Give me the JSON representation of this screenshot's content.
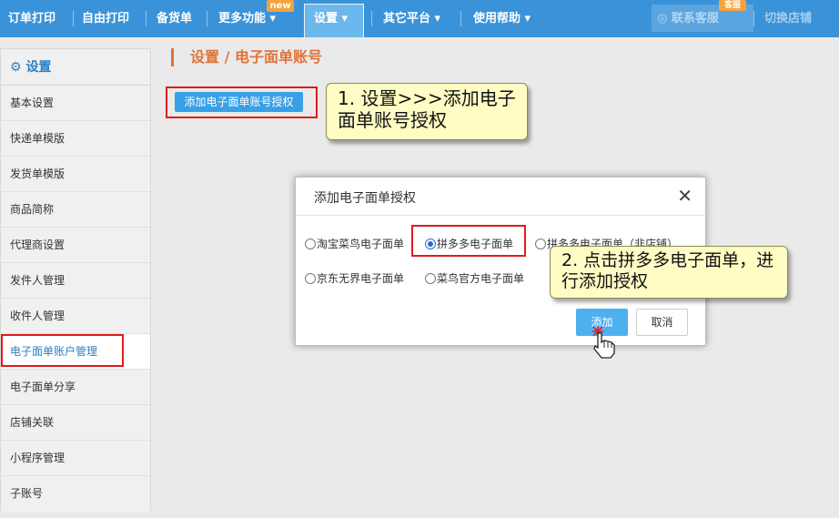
{
  "nav": {
    "items": [
      "订单打印",
      "自由打印",
      "备货单",
      "更多功能 ▾",
      "设置 ▾",
      "其它平台 ▾",
      "使用帮助 ▾"
    ],
    "new_badge": "new",
    "kefu_badge": "客服",
    "contact": "联系客服",
    "switch_store": "切换店铺"
  },
  "sidebar": {
    "header": "设置",
    "items": [
      "基本设置",
      "快递单模版",
      "发货单模版",
      "商品简称",
      "代理商设置",
      "发件人管理",
      "收件人管理",
      "电子面单账户管理",
      "电子面单分享",
      "店铺关联",
      "小程序管理",
      "子账号"
    ]
  },
  "page": {
    "title": "设置 / 电子面单账号",
    "auth_button": "添加电子面单账号授权"
  },
  "callouts": {
    "step1": "1. 设置>>>添加电子面单账号授权",
    "step2": "2. 点击拼多多电子面单，进行添加授权"
  },
  "dialog": {
    "title": "添加电子面单授权",
    "options": [
      "淘宝菜鸟电子面单",
      "拼多多电子面单",
      "拼多多电子面单（非店铺）",
      "京东无界电子面单",
      "菜鸟官方电子面单"
    ],
    "selected": "拼多多电子面单",
    "add": "添加",
    "cancel": "取消"
  },
  "colors": {
    "nav": "#3a93d8",
    "accent_orange": "#e0733a",
    "highlight_red": "#e21b1b",
    "callout_bg": "#fffdc4"
  }
}
